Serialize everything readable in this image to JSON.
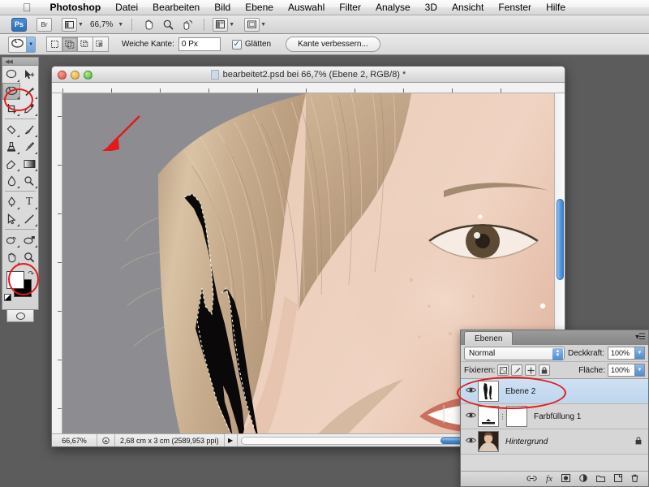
{
  "menubar": {
    "apple_icon": "apple-icon",
    "items": [
      {
        "label": "Photoshop",
        "bold": true
      },
      {
        "label": "Datei"
      },
      {
        "label": "Bearbeiten"
      },
      {
        "label": "Bild"
      },
      {
        "label": "Ebene"
      },
      {
        "label": "Auswahl"
      },
      {
        "label": "Filter"
      },
      {
        "label": "Analyse"
      },
      {
        "label": "3D"
      },
      {
        "label": "Ansicht"
      },
      {
        "label": "Fenster"
      },
      {
        "label": "Hilfe"
      }
    ]
  },
  "appbar": {
    "ps_badge": "Ps",
    "bridge_badge": "Br",
    "screenmode_icon": "screen-mode-icon",
    "zoom_value": "66,7%",
    "hand_icon": "hand-tool-icon",
    "zoom_icon": "zoom-tool-icon",
    "rotate_icon": "rotate-view-icon",
    "arrange_icon": "arrange-documents-icon",
    "screenmodes_icon": "screen-modes-icon"
  },
  "optionsbar": {
    "tool_icon": "lasso-tool-icon",
    "selection_modes": [
      "new-selection",
      "add-to-selection",
      "subtract-from-selection",
      "intersect-selection"
    ],
    "active_selection_mode": 1,
    "feather_label": "Weiche Kante:",
    "feather_value": "0 Px",
    "antialias_label": "Glätten",
    "antialias_checked": true,
    "refine_edge_label": "Kante verbessern..."
  },
  "toolpalette": {
    "tools": [
      {
        "name": "marquee-tool-icon",
        "glyph": "◯"
      },
      {
        "name": "move-tool-icon",
        "glyph": "➤"
      },
      {
        "name": "lasso-tool-icon",
        "glyph": "◠",
        "selected": true
      },
      {
        "name": "magic-wand-tool-icon",
        "glyph": "✦"
      },
      {
        "name": "crop-tool-icon",
        "glyph": "⌗"
      },
      {
        "name": "eyedropper-tool-icon",
        "glyph": "✒"
      },
      {
        "name": "healing-brush-tool-icon",
        "glyph": "▱"
      },
      {
        "name": "brush-tool-icon",
        "glyph": "✎"
      },
      {
        "name": "clone-stamp-tool-icon",
        "glyph": "⎈"
      },
      {
        "name": "history-brush-tool-icon",
        "glyph": "✄"
      },
      {
        "name": "eraser-tool-icon",
        "glyph": "▰"
      },
      {
        "name": "gradient-tool-icon",
        "glyph": "▬"
      },
      {
        "name": "blur-tool-icon",
        "glyph": "◌"
      },
      {
        "name": "dodge-tool-icon",
        "glyph": "◔"
      },
      {
        "name": "pen-tool-icon",
        "glyph": "✑"
      },
      {
        "name": "type-tool-icon",
        "glyph": "T"
      },
      {
        "name": "path-selection-tool-icon",
        "glyph": "➘"
      },
      {
        "name": "line-tool-icon",
        "glyph": "╲"
      },
      {
        "name": "notes-tool-icon",
        "glyph": "✇"
      },
      {
        "name": "3d-rotate-tool-icon",
        "glyph": "✇"
      },
      {
        "name": "hand-tool-icon",
        "glyph": "✋"
      },
      {
        "name": "zoom-tool-icon",
        "glyph": "🔍"
      }
    ],
    "foreground_color": "#ffffff",
    "background_color": "#000000",
    "quickmask_icon": "quick-mask-icon"
  },
  "document": {
    "title": "bearbeitet2.psd bei 66,7% (Ebene 2, RGB/8) *",
    "close_button": "close-window-button",
    "minimize_button": "minimize-window-button",
    "zoom_button": "zoom-window-button",
    "status": {
      "zoom": "66,67%",
      "thumbnail_icon": "document-thumbnail-icon",
      "dimensions": "2,68 cm x 3 cm (2589,953 ppi)",
      "expand_icon": "expand-status-icon"
    },
    "vertical_scrollbar": "vertical-scrollbar",
    "horizontal_scrollbar": "horizontal-scrollbar"
  },
  "layers_panel": {
    "tab_label": "Ebenen",
    "menu_icon": "panel-menu-icon",
    "blend_mode": "Normal",
    "opacity_label": "Deckkraft:",
    "opacity_value": "100%",
    "lock_label": "Fixieren:",
    "lock_icons": [
      "lock-transparency-icon",
      "lock-image-icon",
      "lock-position-icon",
      "lock-all-icon"
    ],
    "fill_label": "Fläche:",
    "fill_value": "100%",
    "layers": [
      {
        "name": "Ebene 2",
        "visible": true,
        "active": true,
        "italic": false,
        "locked": false,
        "kind": "pixel"
      },
      {
        "name": "Farbfüllung 1",
        "visible": true,
        "active": false,
        "italic": false,
        "locked": false,
        "kind": "fill-with-mask"
      },
      {
        "name": "Hintergrund",
        "visible": true,
        "active": false,
        "italic": true,
        "locked": true,
        "kind": "background"
      }
    ],
    "bottom_icons": [
      {
        "name": "link-layers-icon",
        "glyph": "🔗"
      },
      {
        "name": "layer-style-icon",
        "glyph": "fx"
      },
      {
        "name": "layer-mask-icon",
        "glyph": "▣"
      },
      {
        "name": "adjustment-layer-icon",
        "glyph": "◑"
      },
      {
        "name": "new-group-icon",
        "glyph": "▭"
      },
      {
        "name": "new-layer-icon",
        "glyph": "▢"
      },
      {
        "name": "delete-layer-icon",
        "glyph": "🗑"
      }
    ]
  },
  "annotations": {
    "arrow_color": "#e4191c",
    "ellipse_tool_highlight": "lasso-tool-circle",
    "ellipse_color_highlight": "background-color-circle",
    "ellipse_layer_highlight": "ebene-2-layer-circle",
    "arrow_label": "pointer-arrow-to-selection"
  }
}
